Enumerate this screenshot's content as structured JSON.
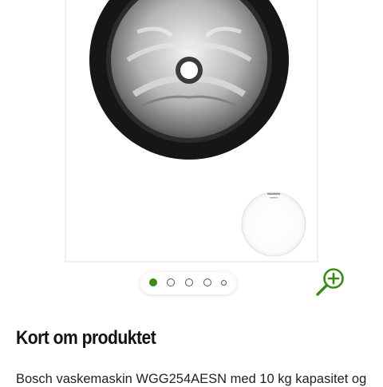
{
  "gallery": {
    "image_name": "washing-machine-image",
    "slide_count": 5,
    "active_slide": 1,
    "zoom_icon": "zoom-in-icon",
    "accent_color": "#3a8a17"
  },
  "product": {
    "section_title": "Kort om produktet",
    "description": "Bosch vaskemaskin WGG254AESN med 10 kg kapasitet og"
  }
}
